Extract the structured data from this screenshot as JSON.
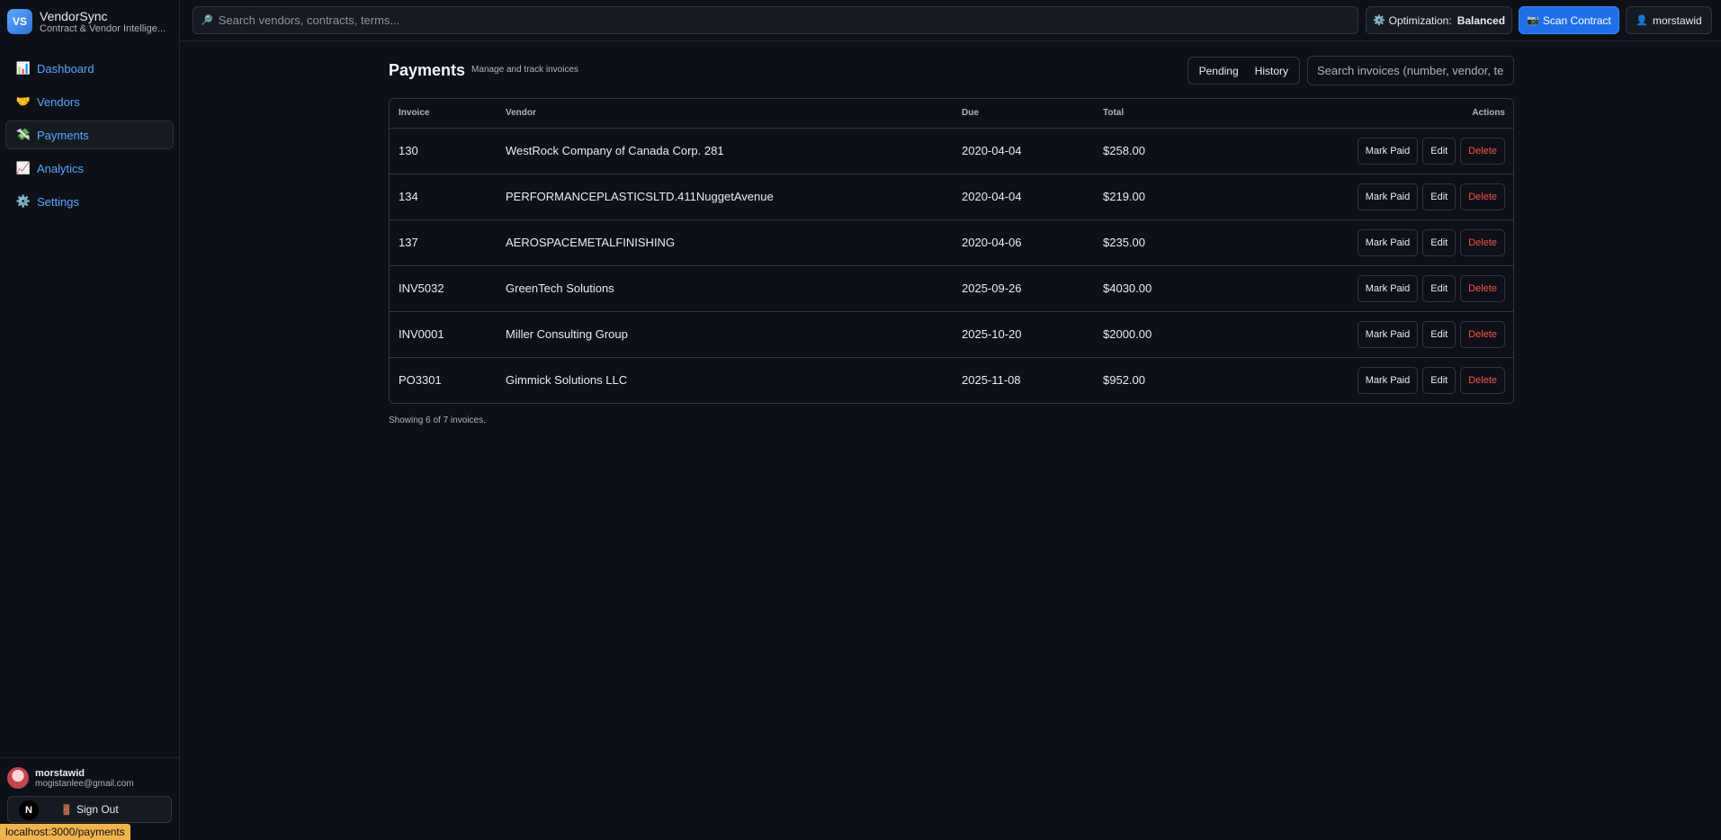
{
  "app": {
    "logo_text": "VS",
    "name": "VendorSync",
    "subtitle": "Contract & Vendor Intellige..."
  },
  "sidebar": {
    "items": [
      {
        "icon": "📊",
        "label": "Dashboard",
        "icon_name": "bar-chart-icon"
      },
      {
        "icon": "🤝",
        "label": "Vendors",
        "icon_name": "handshake-icon"
      },
      {
        "icon": "💸",
        "label": "Payments",
        "icon_name": "money-wings-icon",
        "active": true
      },
      {
        "icon": "📈",
        "label": "Analytics",
        "icon_name": "chart-increasing-icon"
      },
      {
        "icon": "⚙️",
        "label": "Settings",
        "icon_name": "gear-icon"
      }
    ]
  },
  "user": {
    "name": "morstawid",
    "email": "mogistanlee@gmail.com",
    "signout_icon": "🚪",
    "signout_label": "Sign Out",
    "n_badge": "N"
  },
  "status_bar": {
    "url": "localhost:3000/payments"
  },
  "topbar": {
    "search_icon": "🔎",
    "search_placeholder": "Search vendors, contracts, terms...",
    "optimization_icon": "⚙️",
    "optimization_label": "Optimization:",
    "optimization_value": "Balanced",
    "scan_icon": "📷",
    "scan_label": "Scan Contract",
    "user_icon": "👤",
    "user_label": "morstawid"
  },
  "page": {
    "title": "Payments",
    "subtitle": "Manage and track invoices",
    "tabs": [
      "Pending",
      "History"
    ],
    "search_placeholder": "Search invoices (number, vendor, terms...)"
  },
  "table": {
    "headers": {
      "invoice": "Invoice",
      "vendor": "Vendor",
      "due": "Due",
      "total": "Total",
      "actions": "Actions"
    },
    "action_labels": {
      "mark_paid": "Mark Paid",
      "edit": "Edit",
      "delete": "Delete"
    },
    "rows": [
      {
        "invoice": "130",
        "vendor": "WestRock Company of Canada Corp. 281",
        "due": "2020-04-04",
        "total": "$258.00"
      },
      {
        "invoice": "134",
        "vendor": "PERFORMANCEPLASTICSLTD.411NuggetAvenue",
        "due": "2020-04-04",
        "total": "$219.00"
      },
      {
        "invoice": "137",
        "vendor": "AEROSPACEMETALFINISHING",
        "due": "2020-04-06",
        "total": "$235.00"
      },
      {
        "invoice": "INV5032",
        "vendor": "GreenTech Solutions",
        "due": "2025-09-26",
        "total": "$4030.00"
      },
      {
        "invoice": "INV0001",
        "vendor": "Miller Consulting Group",
        "due": "2025-10-20",
        "total": "$2000.00"
      },
      {
        "invoice": "PO3301",
        "vendor": "Gimmick Solutions LLC",
        "due": "2025-11-08",
        "total": "$952.00"
      }
    ]
  },
  "footer": {
    "note": "Showing 6 of 7 invoices."
  }
}
